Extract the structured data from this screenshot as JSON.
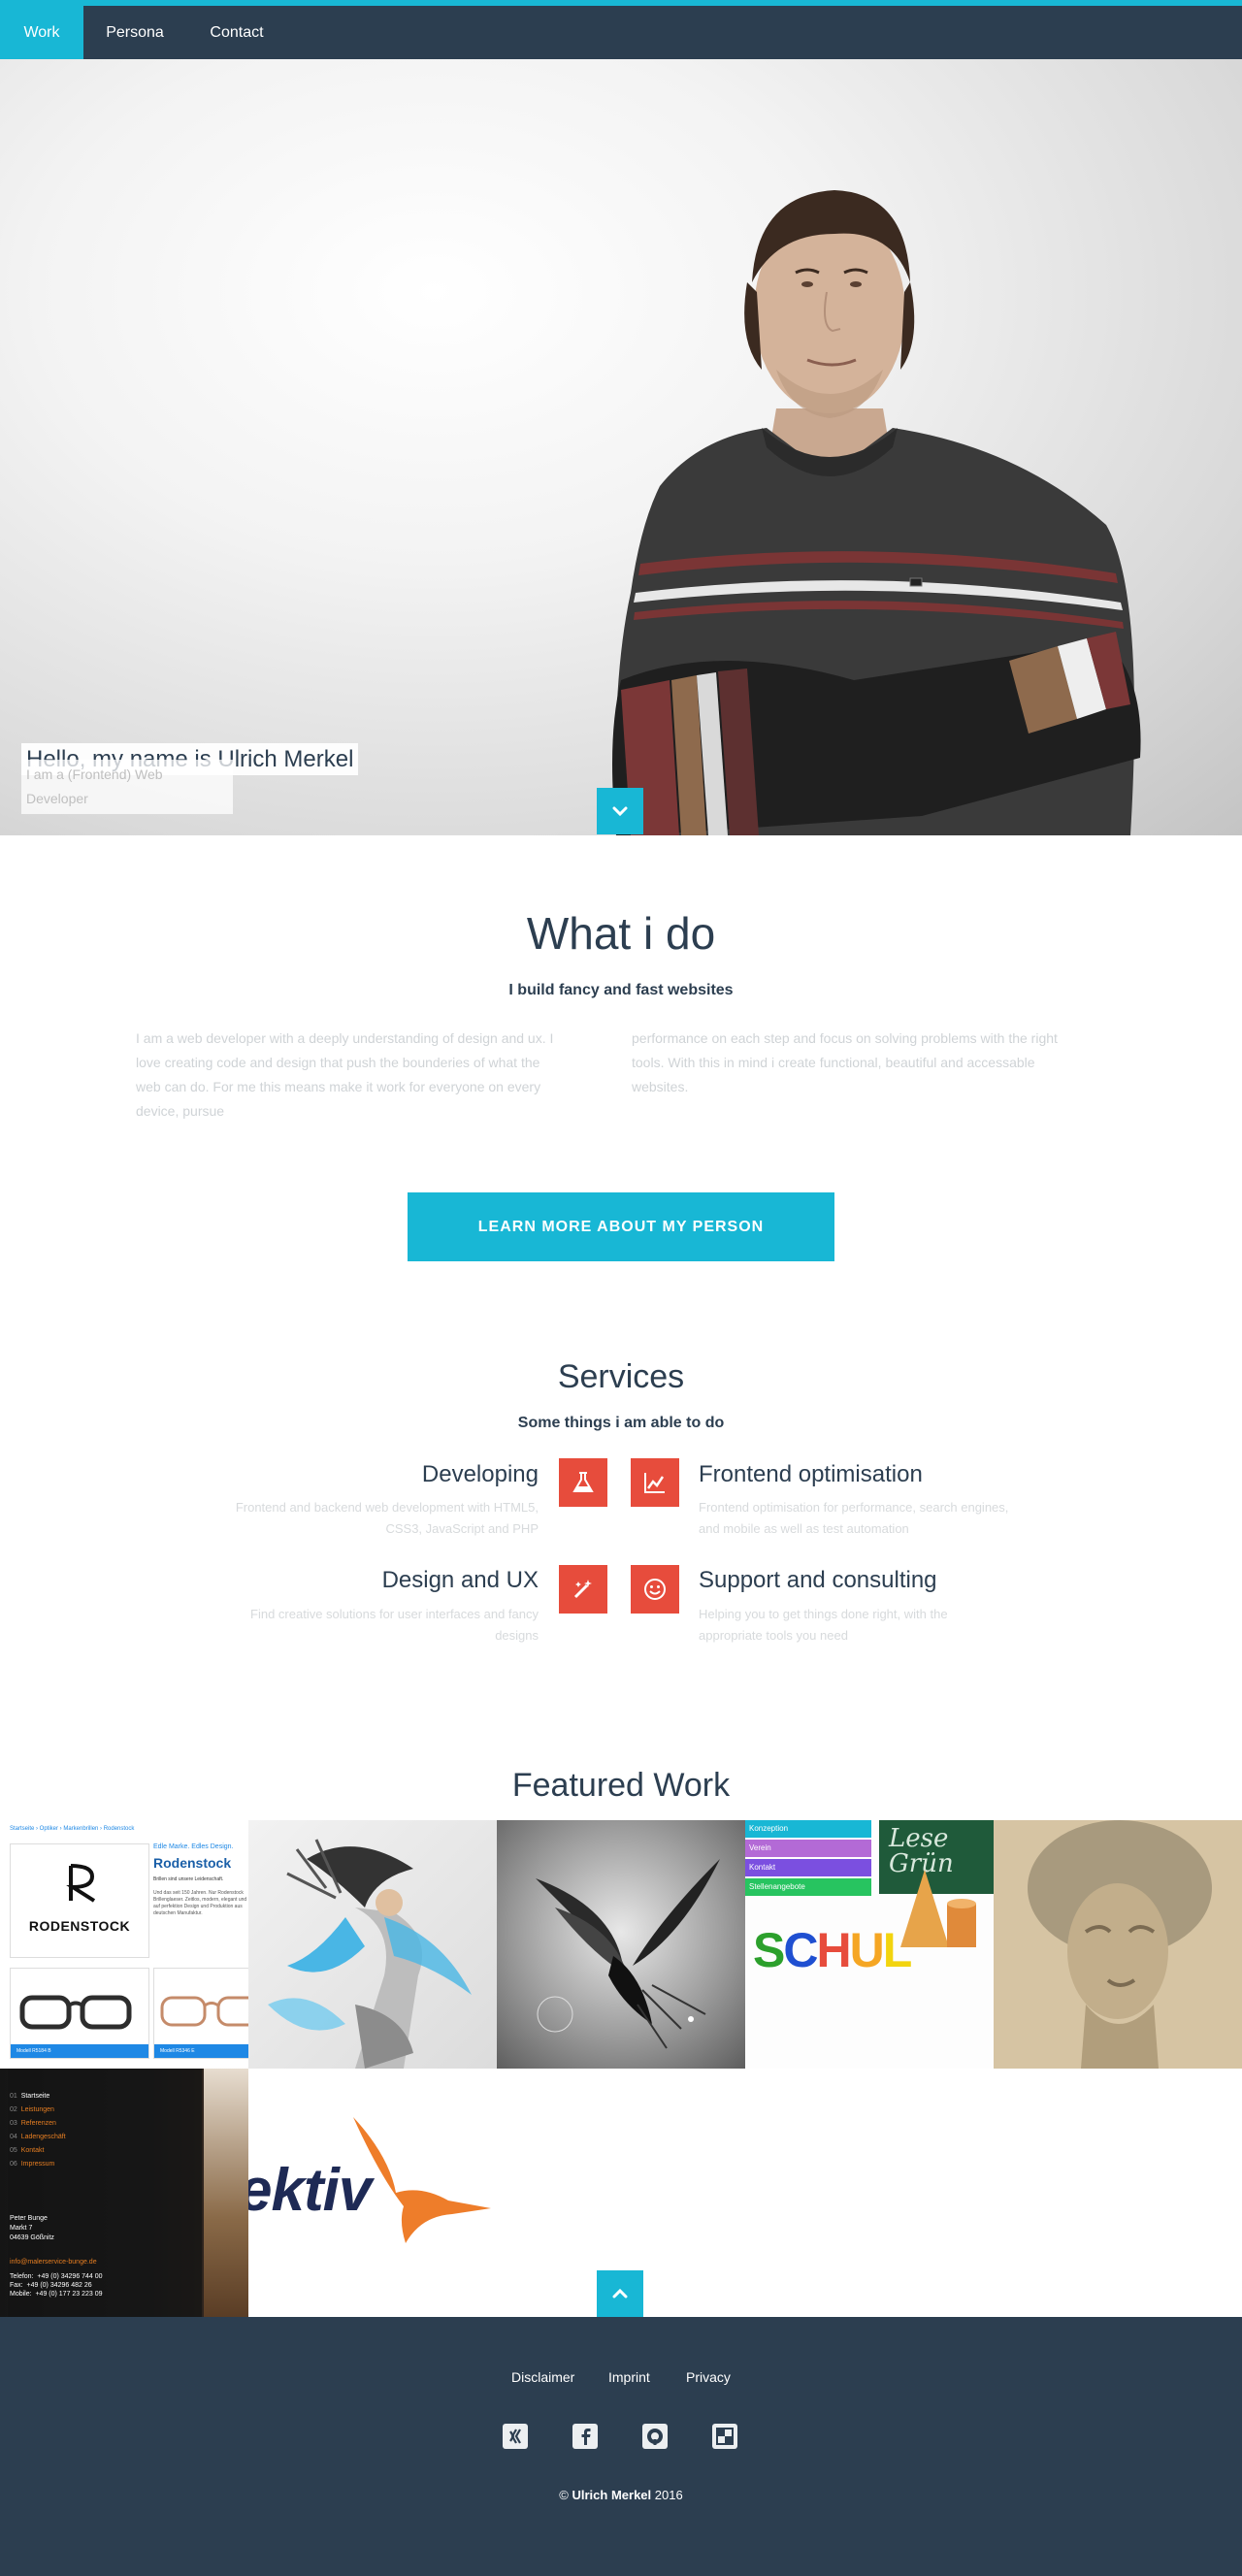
{
  "nav": {
    "items": [
      {
        "label": "Work",
        "active": true
      },
      {
        "label": "Persona",
        "active": false
      },
      {
        "label": "Contact",
        "active": false
      }
    ]
  },
  "hero": {
    "title": "Hello, my name is Ulrich Merkel",
    "subtitle": "I am a (Frontend) Web Developer",
    "scroll_icon": "chevron-down-icon"
  },
  "intro": {
    "title": "What i do",
    "subtitle": "I build fancy and fast websites",
    "col1": "I am a web developer with a deeply understanding of design and ux. I love creating code and design that push the bounderies of what the web can do. For me this means make it work for everyone on every device, pursue",
    "col2": "performance on each step and focus on solving problems with the right tools. With this in mind i create functional, beautiful and accessable websites.",
    "cta_label": "LEARN MORE ABOUT MY PERSON"
  },
  "services": {
    "title": "Services",
    "subtitle": "Some things i am able to do",
    "items": [
      {
        "title": "Developing",
        "desc": "Frontend and backend web development with HTML5, CSS3, JavaScript and PHP",
        "icon": "flask-icon"
      },
      {
        "title": "Frontend optimisation",
        "desc": "Frontend optimisation for performance, search engines, and mobile as well as test automation",
        "icon": "chart-icon"
      },
      {
        "title": "Design and UX",
        "desc": "Find creative solutions for user interfaces and fancy designs",
        "icon": "magic-wand-icon"
      },
      {
        "title": "Support and consulting",
        "desc": "Helping you to get things done right, with the appropriate tools you need",
        "icon": "smiley-icon"
      }
    ]
  },
  "work": {
    "title": "Featured Work",
    "rodenstock": {
      "breadcrumb": "Startseite › Optiker › Markenbrillen › Rodenstock",
      "logo": "RODENSTOCK",
      "tagline": "Edle Marke. Edles Design.",
      "heading": "Rodenstock",
      "text1": "Brillen sind unsere Leidenschaft.",
      "text2": "Und das seit 150 Jahren. Nur Rodenstock Brillenglaeser. Zeitlos, modern, elegant und auf perfektion Design und Produktion aus deutschen Manufaktur.",
      "btn1": "Modell R5184 B",
      "btn2": "Modell R5346 E"
    },
    "school": {
      "menu": [
        "Konzeption",
        "Verein",
        "Kontakt",
        "Stellenangebote"
      ],
      "word": "SCHUL",
      "chalk": "Lese Grün"
    },
    "bunge": {
      "menu": [
        {
          "num": "01",
          "label": "Startseite"
        },
        {
          "num": "02",
          "label": "Leistungen"
        },
        {
          "num": "03",
          "label": "Referenzen"
        },
        {
          "num": "04",
          "label": "Ladengeschäft"
        },
        {
          "num": "05",
          "label": "Kontakt"
        },
        {
          "num": "06",
          "label": "Impressum"
        }
      ],
      "address": [
        "Peter Bunge",
        "Markt 7",
        "04639 Gößnitz"
      ],
      "email": "info@malerservice-bunge.de",
      "phones": [
        {
          "k": "Telefon:",
          "v": "+49 (0) 34296 744 00"
        },
        {
          "k": "Fax:",
          "v": "+49 (0) 34296 482 26"
        },
        {
          "k": "Mobile:",
          "v": "+49 (0) 177 23 223 09"
        }
      ]
    },
    "ektiv": {
      "word": "ektiv"
    }
  },
  "footer": {
    "links": [
      "Disclaimer",
      "Imprint",
      "Privacy"
    ],
    "social_icons": [
      "xing-icon",
      "facebook-icon",
      "github-icon",
      "delicious-icon"
    ],
    "copyright_prefix": "© ",
    "copyright_name": "Ulrich Merkel",
    "copyright_year": " 2016"
  },
  "colors": {
    "accent": "#18b7d5",
    "dark": "#2c3e50",
    "service_icon": "#e74c3c",
    "muted_text": "#cfd3d6"
  }
}
